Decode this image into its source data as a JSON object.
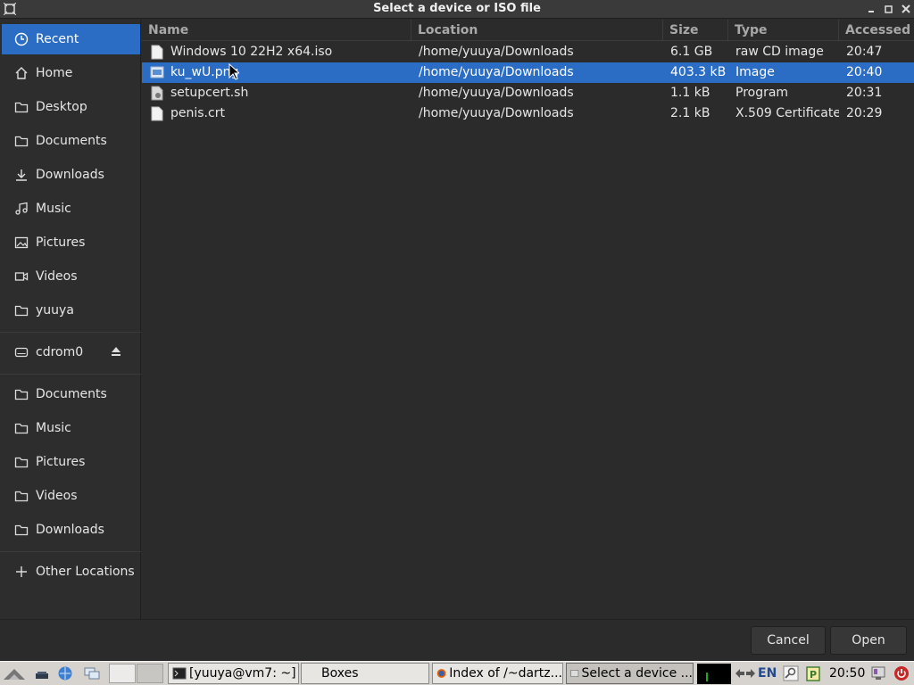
{
  "window": {
    "title": "Select a device or ISO file"
  },
  "sidebar": {
    "items": [
      {
        "label": "Recent",
        "icon": "clock-icon",
        "selected": true
      },
      {
        "label": "Home",
        "icon": "home-icon"
      },
      {
        "label": "Desktop",
        "icon": "folder-icon"
      },
      {
        "label": "Documents",
        "icon": "folder-icon"
      },
      {
        "label": "Downloads",
        "icon": "download-icon"
      },
      {
        "label": "Music",
        "icon": "music-icon"
      },
      {
        "label": "Pictures",
        "icon": "picture-icon"
      },
      {
        "label": "Videos",
        "icon": "video-icon"
      },
      {
        "label": "yuuya",
        "icon": "folder-icon"
      },
      {
        "label": "cdrom0",
        "icon": "drive-icon"
      },
      {
        "label": "Documents",
        "icon": "folder-icon"
      },
      {
        "label": "Music",
        "icon": "folder-icon"
      },
      {
        "label": "Pictures",
        "icon": "folder-icon"
      },
      {
        "label": "Videos",
        "icon": "folder-icon"
      },
      {
        "label": "Downloads",
        "icon": "folder-icon"
      },
      {
        "label": "Other Locations",
        "icon": "plus-icon"
      }
    ]
  },
  "filelist": {
    "columns": [
      "Name",
      "Location",
      "Size",
      "Type",
      "Accessed"
    ],
    "rows": [
      {
        "name": "Windows 10 22H2 x64.iso",
        "location": "/home/yuuya/Downloads",
        "size": "6.1 GB",
        "type": "raw CD image",
        "accessed": "20:47",
        "icon": "file-icon"
      },
      {
        "name": "ku_wU.png",
        "location": "/home/yuuya/Downloads",
        "size": "403.3 kB",
        "type": "Image",
        "accessed": "20:40",
        "icon": "image-file-icon",
        "selected": true
      },
      {
        "name": "setupcert.sh",
        "location": "/home/yuuya/Downloads",
        "size": "1.1 kB",
        "type": "Program",
        "accessed": "20:31",
        "icon": "script-file-icon"
      },
      {
        "name": "penis.crt",
        "location": "/home/yuuya/Downloads",
        "size": "2.1 kB",
        "type": "X.509 Certificate",
        "accessed": "20:29",
        "icon": "file-icon"
      }
    ]
  },
  "buttons": {
    "cancel": "Cancel",
    "open": "Open"
  },
  "taskbar": {
    "tasks": [
      {
        "label": "[yuuya@vm7: ~]",
        "icon": "terminal-icon"
      },
      {
        "label": "Boxes",
        "icon": "none"
      },
      {
        "label": "Index of /~dartz...",
        "icon": "firefox-icon"
      },
      {
        "label": "Select a device ...",
        "icon": "dialog-icon",
        "active": true
      }
    ],
    "language": "EN",
    "clock": "20:50"
  },
  "colors": {
    "accent": "#2b6cc4",
    "background": "#2b2b2b",
    "sidebar": "#2d2d2d",
    "taskbar": "#d6d3ce"
  }
}
